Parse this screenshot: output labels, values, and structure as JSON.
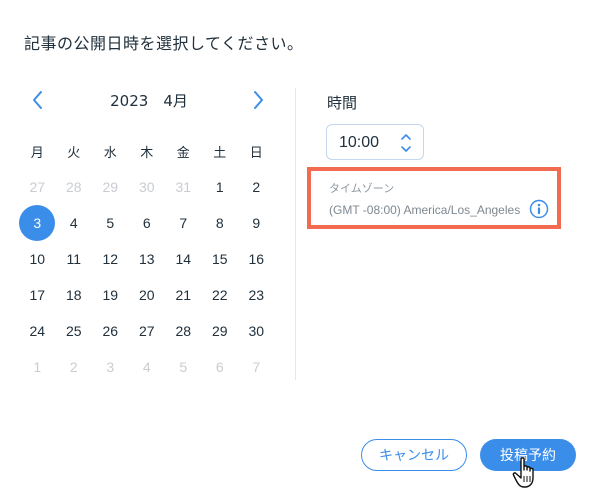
{
  "prompt": "記事の公開日時を選択してください。",
  "calendar": {
    "month_label": "2023　4月",
    "weekdays": [
      "月",
      "火",
      "水",
      "木",
      "金",
      "土",
      "日"
    ],
    "weeks": [
      [
        "27",
        "28",
        "29",
        "30",
        "31",
        "1",
        "2"
      ],
      [
        "3",
        "4",
        "5",
        "6",
        "7",
        "8",
        "9"
      ],
      [
        "10",
        "11",
        "12",
        "13",
        "14",
        "15",
        "16"
      ],
      [
        "17",
        "18",
        "19",
        "20",
        "21",
        "22",
        "23"
      ],
      [
        "24",
        "25",
        "26",
        "27",
        "28",
        "29",
        "30"
      ],
      [
        "1",
        "2",
        "3",
        "4",
        "5",
        "6",
        "7"
      ]
    ],
    "selected_day": "3"
  },
  "time": {
    "label": "時間",
    "value": "10:00"
  },
  "timezone": {
    "label": "タイムゾーン",
    "value": "(GMT -08:00) America/Los_Angeles"
  },
  "buttons": {
    "cancel": "キャンセル",
    "schedule": "投稿予約"
  },
  "colors": {
    "accent": "#3b8dea",
    "highlight": "#f26a4f",
    "muted": "#c9ccd1"
  }
}
